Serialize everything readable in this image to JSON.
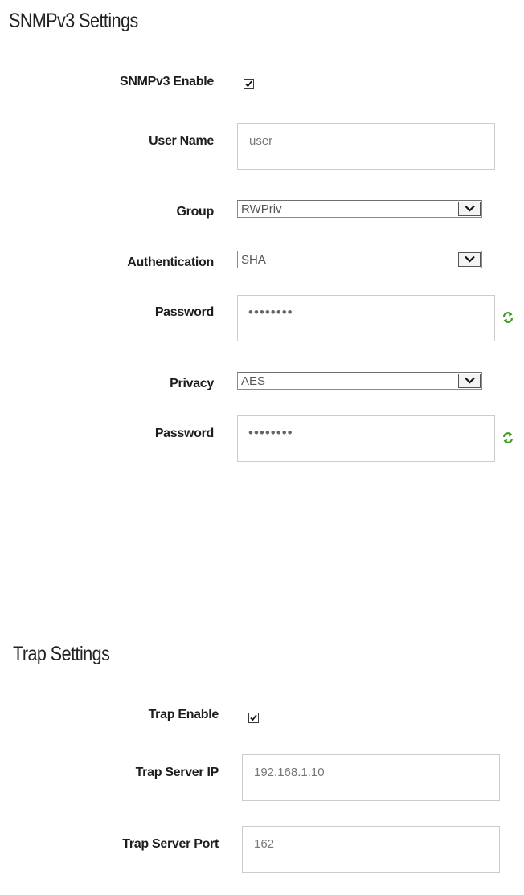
{
  "snmpv3": {
    "title": "SNMPv3 Settings",
    "enable_label": "SNMPv3 Enable",
    "enable_checked": true,
    "username_label": "User Name",
    "username_value": "user",
    "group_label": "Group",
    "group_value": "RWPriv",
    "auth_label": "Authentication",
    "auth_value": "SHA",
    "auth_password_label": "Password",
    "auth_password_mask": "••••••••",
    "privacy_label": "Privacy",
    "privacy_value": "AES",
    "privacy_password_label": "Password",
    "privacy_password_mask": "••••••••"
  },
  "trap": {
    "title": "Trap Settings",
    "enable_label": "Trap Enable",
    "enable_checked": true,
    "server_ip_label": "Trap Server IP",
    "server_ip_value": "192.168.1.10",
    "server_port_label": "Trap Server Port",
    "server_port_value": "162"
  },
  "icons": {
    "checkmark": "checkmark-icon",
    "dropdown_arrow": "chevron-down-icon",
    "refresh": "refresh-icon",
    "refresh_color": "#3d9a1e"
  }
}
